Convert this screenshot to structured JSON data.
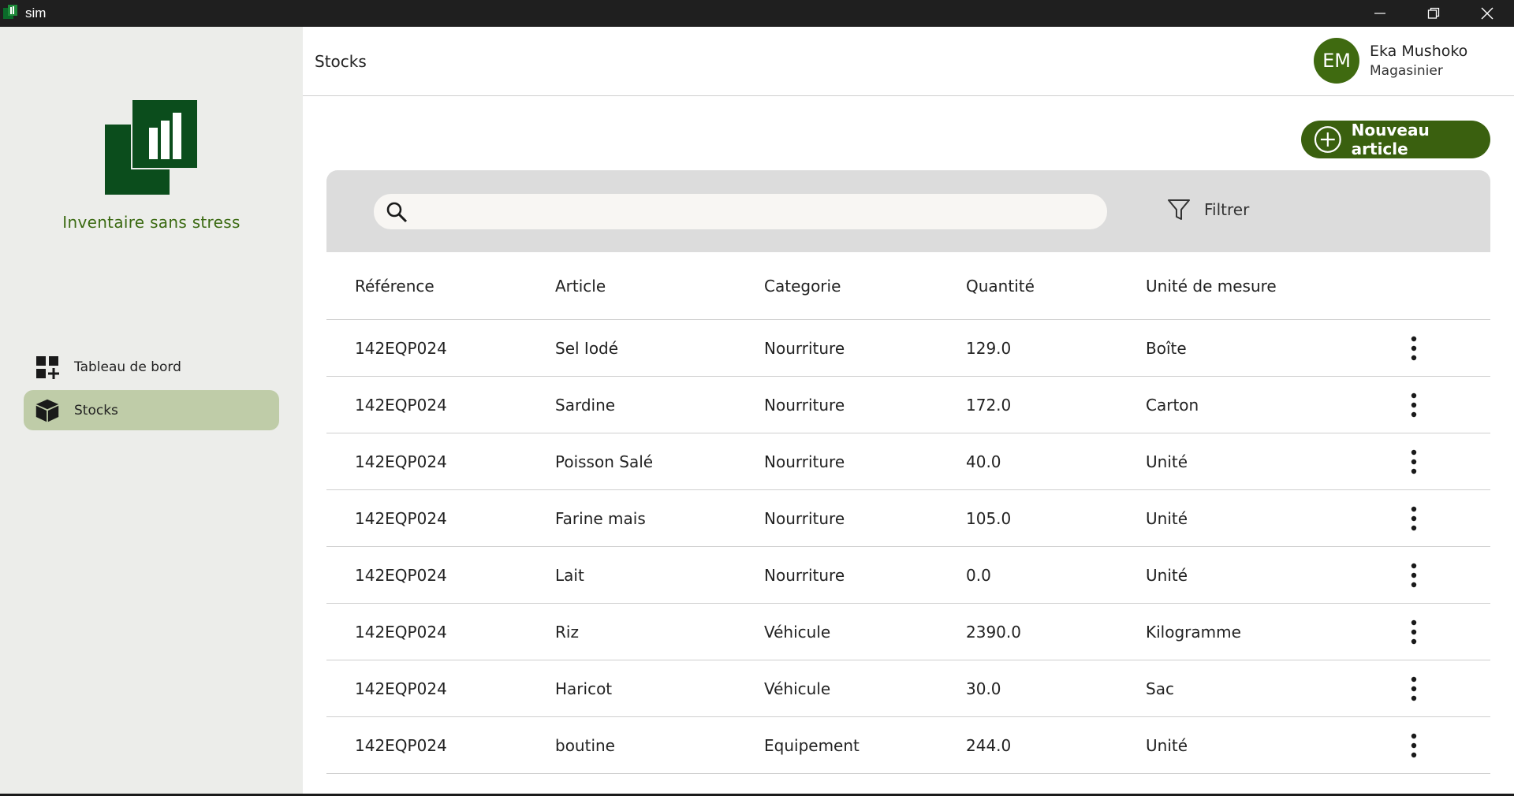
{
  "window": {
    "title": "sim"
  },
  "sidebar": {
    "brand": "Inventaire sans stress",
    "items": [
      {
        "label": "Tableau de bord",
        "icon": "dashboard-add-icon",
        "active": false
      },
      {
        "label": "Stocks",
        "icon": "box-icon",
        "active": true
      }
    ]
  },
  "header": {
    "title": "Stocks",
    "user": {
      "initials": "EM",
      "name": "Eka Mushoko",
      "role": "Magasinier"
    }
  },
  "actions": {
    "new_article": "Nouveau article"
  },
  "search": {
    "value": "",
    "placeholder": ""
  },
  "filter": {
    "label": "Filtrer"
  },
  "table": {
    "columns": [
      "Référence",
      "Article",
      "Categorie",
      "Quantité",
      "Unité de mesure"
    ],
    "rows": [
      [
        "142EQP024",
        "Sel Iodé",
        "Nourriture",
        "129.0",
        "Boîte"
      ],
      [
        "142EQP024",
        "Sardine",
        "Nourriture",
        "172.0",
        "Carton"
      ],
      [
        "142EQP024",
        "Poisson Salé",
        "Nourriture",
        "40.0",
        "Unité"
      ],
      [
        "142EQP024",
        "Farine mais",
        "Nourriture",
        "105.0",
        "Unité"
      ],
      [
        "142EQP024",
        "Lait",
        "Nourriture",
        "0.0",
        "Unité"
      ],
      [
        "142EQP024",
        "Riz",
        "Véhicule",
        "2390.0",
        "Kilogramme"
      ],
      [
        "142EQP024",
        "Haricot",
        "Véhicule",
        "30.0",
        "Sac"
      ],
      [
        "142EQP024",
        "boutine",
        "Equipement",
        "244.0",
        "Unité"
      ]
    ]
  },
  "colors": {
    "brand_green": "#3a600f",
    "logo_dark_green": "#0b4d1c",
    "active_nav": "#bfcca8",
    "sidebar_bg": "#ecedea",
    "toolbar_bg": "#dcdcdc"
  }
}
